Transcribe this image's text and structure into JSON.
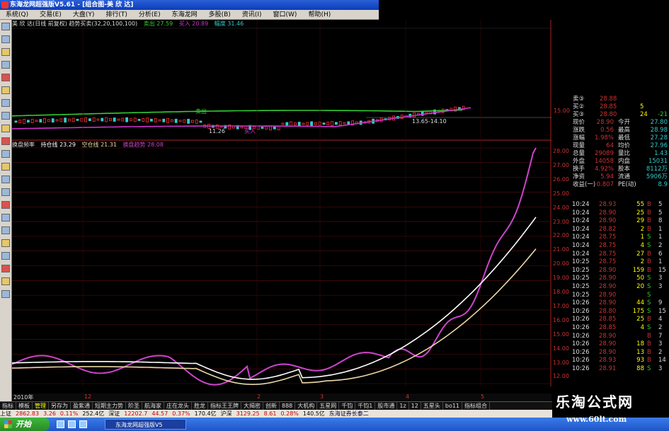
{
  "window": {
    "title": "东海龙网超强版V5.61 - [组合图-美 欣 达]"
  },
  "menu": [
    "系统(Q)",
    "交易(E)",
    "大盘(Y)",
    "排行(T)",
    "分析(E)",
    "东海龙网",
    "多股(B)",
    "资讯(I)",
    "窗口(W)",
    "帮助(H)"
  ],
  "top_panel": {
    "indicator": "美 欣 达(日线 前复权) 趋势买卖(32,20,100,100)",
    "sell_label": "卖出 27.59",
    "buy_label": "买入 20.89",
    "range_label": "幅度 31.46",
    "annot_low": "11.26",
    "annot_buy": "买入",
    "annot_sell": "卖出",
    "annot_range": "13.65-14.10",
    "price_15": "15.00",
    "colors": {
      "green": "#33cc33",
      "magenta": "#cc33cc",
      "red": "#ff3333",
      "cyan": "#33cccc"
    }
  },
  "bottom_panel": {
    "name": "换盘频率",
    "hold_label": "持仓线 23.29",
    "empty_label": "空仓线 21.31",
    "trend_label": "换盘趋势 28.08",
    "y_ticks": [
      "28.00",
      "27.00",
      "26.00",
      "25.00",
      "24.00",
      "23.00",
      "22.00",
      "21.00",
      "20.00",
      "19.00",
      "18.00",
      "17.00",
      "16.00",
      "15.00",
      "14.00",
      "13.00",
      "12.00"
    ],
    "colors": {
      "trend": "#cc44cc",
      "hold": "#ffffff",
      "empty": "#e8d8a8"
    }
  },
  "quote": {
    "rows": [
      {
        "label": "卖③",
        "price": "28.88",
        "vol": "",
        "extra": ""
      },
      {
        "label": "买②",
        "price": "28.85",
        "vol": "5",
        "extra": ""
      },
      {
        "label": "买③",
        "price": "28.80",
        "vol": "24",
        "extra": "-21"
      },
      {
        "label": "现价",
        "price": "28.90",
        "label2": "今开",
        "val2": "27.80"
      },
      {
        "label": "涨跌",
        "price": "0.56",
        "label2": "最高",
        "val2": "28.98"
      },
      {
        "label": "涨幅",
        "price": "1.98%",
        "label2": "最低",
        "val2": "27.28"
      },
      {
        "label": "现量",
        "price": "64",
        "label2": "均价",
        "val2": "27.96"
      },
      {
        "label": "总量",
        "price": "29089",
        "label2": "量比",
        "val2": "1.43"
      },
      {
        "label": "外盘",
        "price": "14058",
        "label2": "内盘",
        "val2": "15031"
      },
      {
        "label": "换手",
        "price": "4.92%",
        "label2": "股本",
        "val2": "8112万"
      },
      {
        "label": "净资",
        "price": "5.94",
        "label2": "流通",
        "val2": "5906万"
      },
      {
        "label": "收益(一)",
        "price": "0.807",
        "label2": "PE(动)",
        "val2": "8.9"
      }
    ]
  },
  "trades": [
    {
      "t": "10:24",
      "p": "28.93",
      "v": "55",
      "s": "B",
      "n": "5"
    },
    {
      "t": "10:24",
      "p": "28.90",
      "v": "25",
      "s": "B",
      "n": "5"
    },
    {
      "t": "10:24",
      "p": "28.90",
      "v": "29",
      "s": "B",
      "n": "8"
    },
    {
      "t": "10:24",
      "p": "28.82",
      "v": "2",
      "s": "B",
      "n": "1"
    },
    {
      "t": "10:24",
      "p": "28.75",
      "v": "1",
      "s": "S",
      "n": "1"
    },
    {
      "t": "10:24",
      "p": "28.75",
      "v": "4",
      "s": "S",
      "n": "2"
    },
    {
      "t": "10:24",
      "p": "28.75",
      "v": "27",
      "s": "B",
      "n": "6"
    },
    {
      "t": "10:25",
      "p": "28.75",
      "v": "2",
      "s": "B",
      "n": "1"
    },
    {
      "t": "10:25",
      "p": "28.90",
      "v": "159",
      "s": "B",
      "n": "15"
    },
    {
      "t": "10:25",
      "p": "28.90",
      "v": "50",
      "s": "S",
      "n": "3"
    },
    {
      "t": "10:25",
      "p": "28.90",
      "v": "20",
      "s": "S",
      "n": "3"
    },
    {
      "t": "10:25",
      "p": "28.90",
      "v": "",
      "s": "S",
      "n": ""
    },
    {
      "t": "10:26",
      "p": "28.90",
      "v": "44",
      "s": "S",
      "n": "9"
    },
    {
      "t": "10:26",
      "p": "28.80",
      "v": "175",
      "s": "S",
      "n": "15"
    },
    {
      "t": "10:26",
      "p": "28.85",
      "v": "25",
      "s": "B",
      "n": "4"
    },
    {
      "t": "10:26",
      "p": "28.85",
      "v": "4",
      "s": "S",
      "n": "2"
    },
    {
      "t": "10:26",
      "p": "28.90",
      "v": "",
      "s": "B",
      "n": "7"
    },
    {
      "t": "10:26",
      "p": "28.90",
      "v": "18",
      "s": "B",
      "n": "3"
    },
    {
      "t": "10:26",
      "p": "28.90",
      "v": "13",
      "s": "B",
      "n": "2"
    },
    {
      "t": "10:26",
      "p": "28.93",
      "v": "93",
      "s": "B",
      "n": "14"
    },
    {
      "t": "10:26",
      "p": "28.91",
      "v": "88",
      "s": "S",
      "n": "3"
    }
  ],
  "xaxis": [
    "2010年",
    "12",
    "2",
    "3",
    "4",
    "5"
  ],
  "tabs": [
    "指标",
    "模板",
    "管理",
    "另存为",
    "盈紫通",
    "短期主力势",
    "阶圣",
    "航海家",
    "庄在龙头",
    "胜龙",
    "指标王王牌",
    "大揭密",
    "创新",
    "888",
    "大机构",
    "五星网",
    "千钧",
    "千钧1",
    "股市通",
    "1z",
    "12",
    "五星头",
    "bo11",
    "指标组合"
  ],
  "status": {
    "index1_name": "上证",
    "index1": "2862.83",
    "index1_chg": "3.26",
    "index1_pct": "0.11%",
    "amount1": "252.4亿",
    "index2_name": "深证",
    "index2": "12202.7",
    "index2_chg": "44.57",
    "index2_pct": "0.37%",
    "amount2": "170.4亿",
    "index3_name": "沪深",
    "index3": "3129.25",
    "index3_chg": "8.61",
    "index3_pct": "0.28%",
    "amount3": "140.5亿",
    "broker": "东海证券长泰二"
  },
  "taskbar": {
    "start": "开始",
    "app": "东海龙网超强版V5"
  },
  "watermark": {
    "line1": "乐淘公式网",
    "line2": "www.60lt.com"
  }
}
